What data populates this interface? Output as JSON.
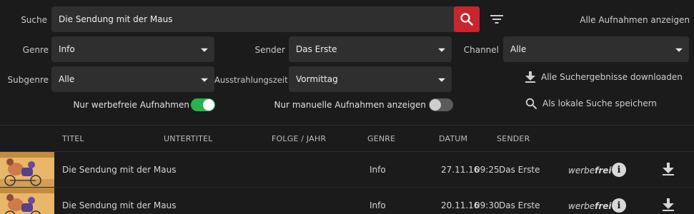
{
  "search": {
    "label": "Suche",
    "value": "Die Sendung mit der Maus",
    "show_all_label": "Alle Aufnahmen anzeigen"
  },
  "filters": {
    "genre": {
      "label": "Genre",
      "value": "Info"
    },
    "sender": {
      "label": "Sender",
      "value": "Das Erste"
    },
    "channel": {
      "label": "Channel",
      "value": "Alle"
    },
    "subgenre": {
      "label": "Subgenre",
      "value": "Alle"
    },
    "ausstrahlungszeit": {
      "label": "Ausstrahlungszeit",
      "value": "Vormittag"
    },
    "werbefrei_toggle": {
      "label": "Nur werbefreie Aufnahmen",
      "on": true
    },
    "manuell_toggle": {
      "label": "Nur manuelle Aufnahmen anzeigen",
      "on": false
    }
  },
  "actions": {
    "download_all": "Alle Suchergebnisse downloaden",
    "save_search": "Als lokale Suche speichern"
  },
  "table": {
    "headers": {
      "titel": "TITEL",
      "untertitel": "UNTERTITEL",
      "folge_jahr": "FOLGE / JAHR",
      "genre": "GENRE",
      "datum": "DATUM",
      "sender": "SENDER"
    },
    "rows": [
      {
        "title": "Die Sendung mit der Maus",
        "untertitel": "",
        "folge_jahr": "",
        "genre": "Info",
        "date": "27.11.16",
        "time": "09:25",
        "sender": "Das Erste",
        "badge_light": "werbe",
        "badge_bold": "frei"
      },
      {
        "title": "Die Sendung mit der Maus",
        "untertitel": "",
        "folge_jahr": "",
        "genre": "Info",
        "date": "20.11.16",
        "time": "09:30",
        "sender": "Das Erste",
        "badge_light": "werbe",
        "badge_bold": "frei"
      }
    ]
  },
  "colors": {
    "background": "#1b1b1b",
    "field": "#2f2f2f",
    "accent_red": "#c9252d",
    "toggle_on": "#2ab24b"
  },
  "icons": {
    "search_button": "search-icon",
    "filter": "filter-icon",
    "download": "download-icon",
    "save_search": "magnifier-icon",
    "info": "info-icon"
  }
}
